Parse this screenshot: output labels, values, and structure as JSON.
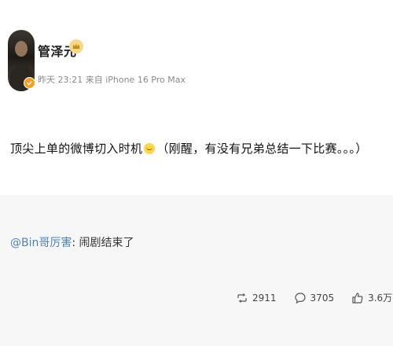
{
  "post": {
    "username": "管泽元",
    "meta": "昨天 23:21 来自 iPhone 16 Pro Max",
    "text_before": "顶尖上单的微博切入时机",
    "text_after": "（刚醒，有没有兄弟总结一下比赛。。。）"
  },
  "retweet": {
    "mention": "@Bin哥厉害",
    "separator": ":",
    "text": " 闹剧结束了"
  },
  "actions": {
    "repost_count": "2911",
    "comment_count": "3705",
    "like_count": "3.6万"
  },
  "icons": {
    "verified": "verified-badge-icon",
    "crown": "crown-icon",
    "emoji": "smile-emoji-icon",
    "repost": "repost-icon",
    "comment": "comment-icon",
    "like": "thumbs-up-icon"
  },
  "colors": {
    "mention": "#4e7fb8",
    "meta": "#8a8a8a",
    "retweet_background": "#f7f7f7",
    "verified": "#f4a11c"
  }
}
